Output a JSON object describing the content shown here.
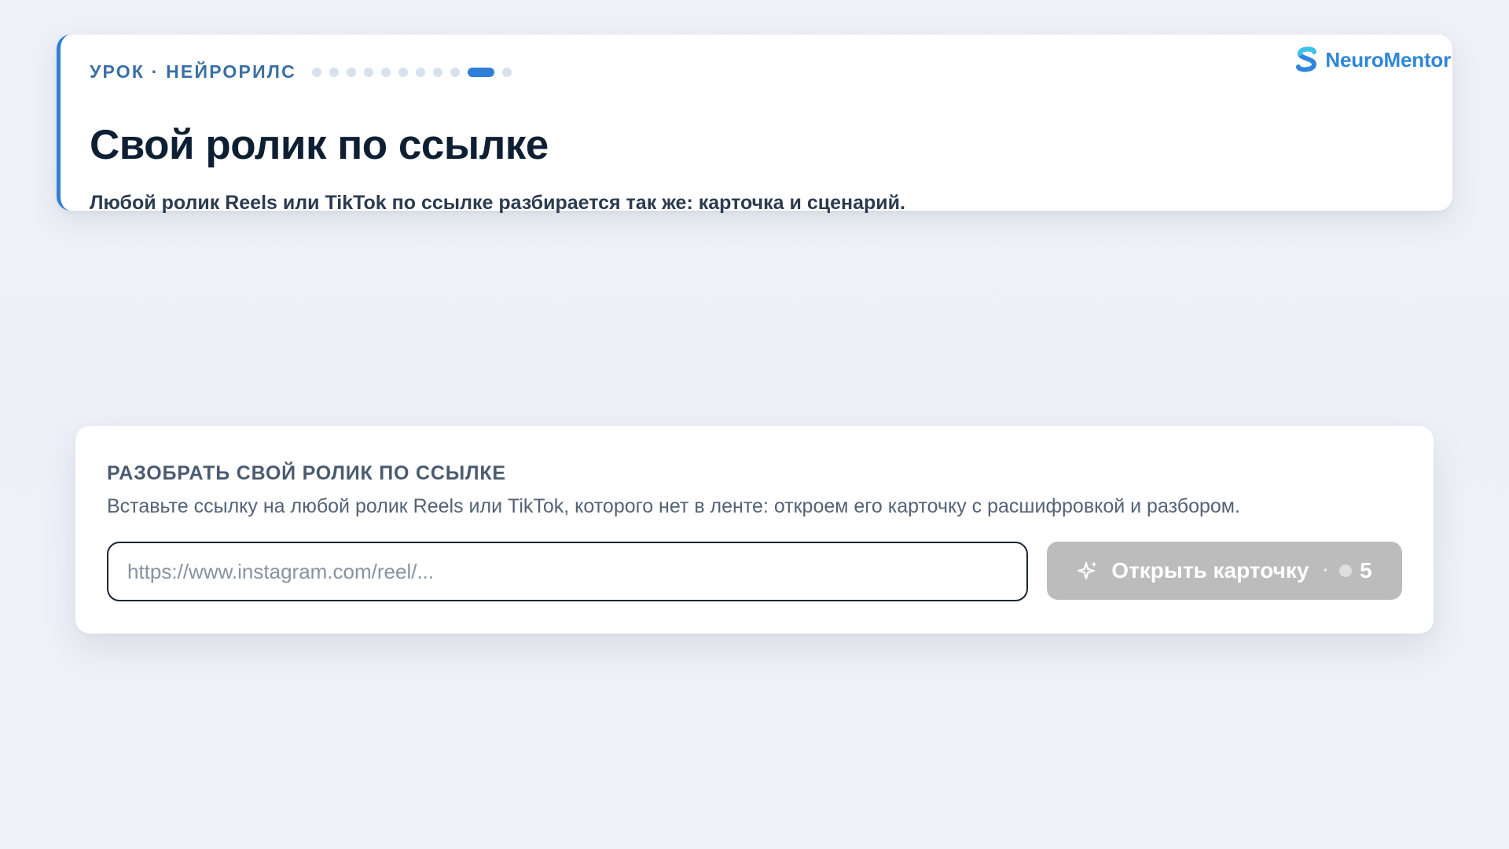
{
  "lesson": {
    "kicker": "УРОК · НЕЙРОРИЛС",
    "title": "Свой ролик по ссылке",
    "subtitle": "Любой ролик Reels или TikTok по ссылке разбирается так же: карточка и сценарий.",
    "progress": {
      "total_steps": 11,
      "current_step": 10
    }
  },
  "brand": {
    "name": "NeuroMentor",
    "icon": "neuromentor-logo-icon",
    "color": "#2f86db"
  },
  "link_form": {
    "heading": "РАЗОБРАТЬ СВОЙ РОЛИК ПО ССЫЛКЕ",
    "description": "Вставьте ссылку на любой ролик Reels или TikTok, которого нет в ленте: откроем его карточку с расшифровкой и разбором.",
    "input": {
      "value": "",
      "placeholder": "https://www.instagram.com/reel/..."
    },
    "button": {
      "label": "Открыть карточку",
      "separator": "·",
      "cost": "5",
      "icon": "sparkle-icon",
      "cost_icon": "coin-icon",
      "state": "disabled",
      "color": "#bcbcbc"
    }
  },
  "colors": {
    "accent": "#2f7fd8",
    "title": "#0f1f33",
    "background": "#eef2f7"
  }
}
